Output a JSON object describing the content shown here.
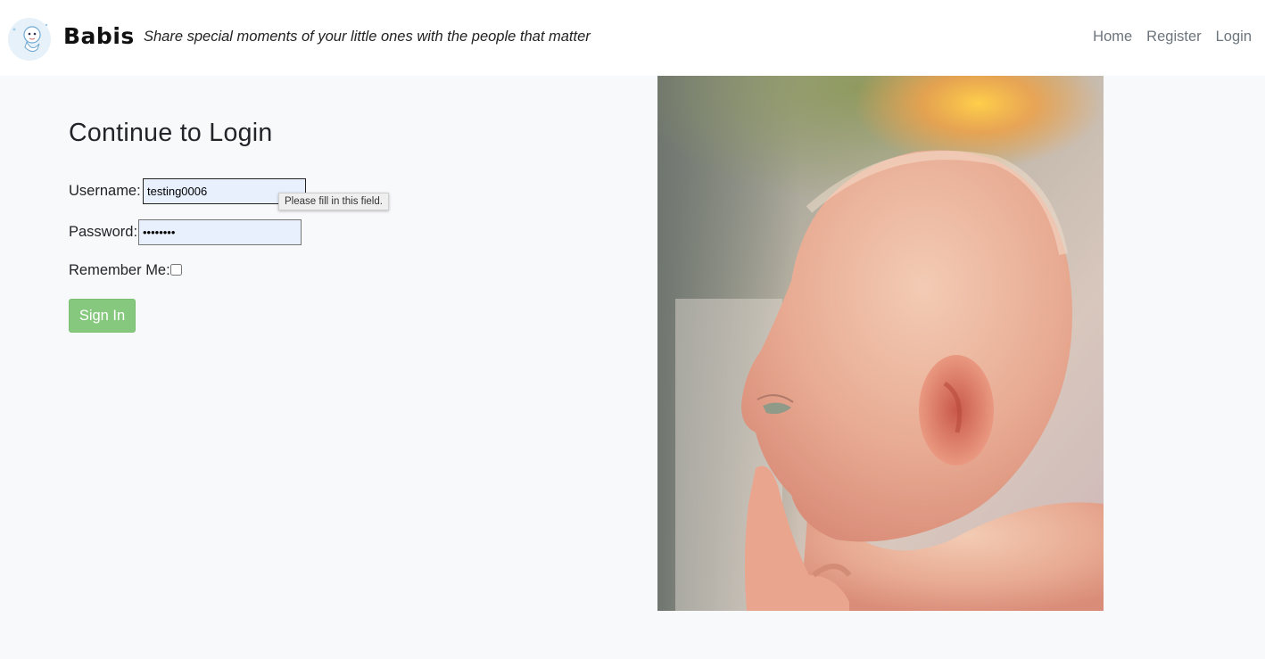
{
  "header": {
    "brand": "Babis",
    "tagline": "Share special moments of your little ones with the people that matter",
    "logo_icon": "baby-moon-logo-icon",
    "nav": [
      {
        "label": "Home"
      },
      {
        "label": "Register"
      },
      {
        "label": "Login"
      }
    ]
  },
  "login_form": {
    "title": "Continue to Login",
    "username_label": "Username:",
    "username_value": "testing0006",
    "password_label": "Password:",
    "password_value": "••••••••",
    "remember_label": "Remember Me:",
    "remember_checked": false,
    "submit_label": "Sign In",
    "validation_tooltip": "Please fill in this field."
  },
  "colors": {
    "page_background": "#f8f9fa",
    "navbar_background": "#ffffff",
    "nav_link": "#6c757d",
    "button": "#86c87e",
    "input_autofill": "#e8f0fe"
  },
  "photo": {
    "icon": "baby-profile-photo"
  }
}
